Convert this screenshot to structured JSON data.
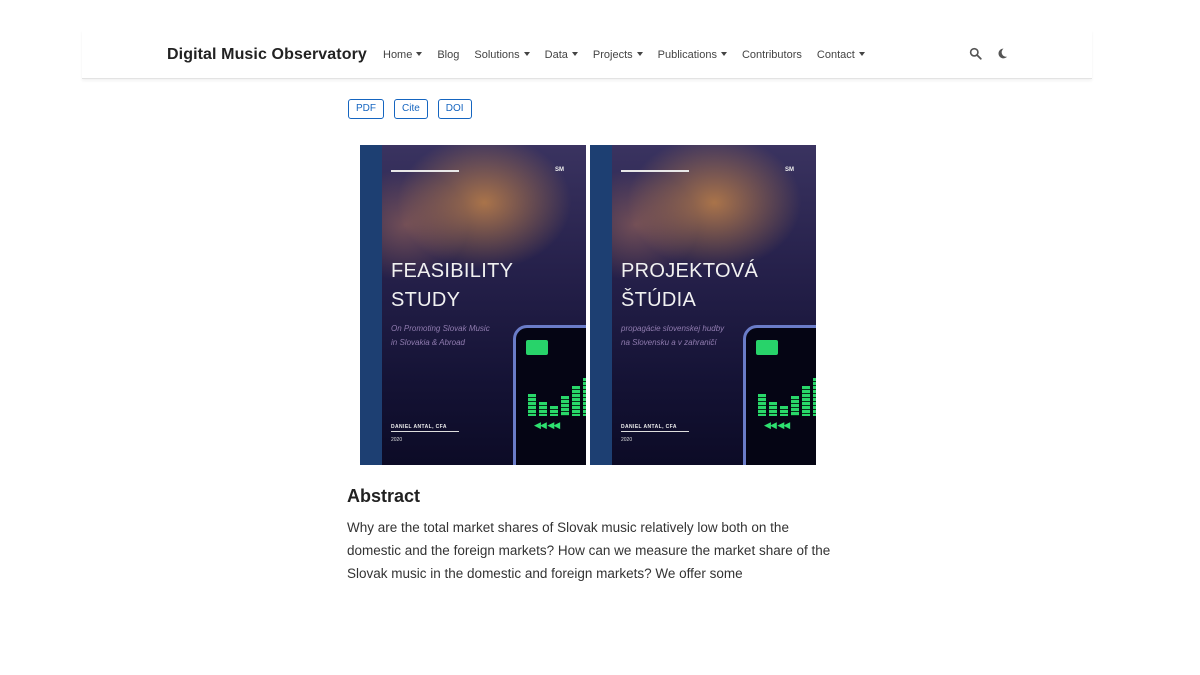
{
  "brand": "Digital Music Observatory",
  "nav": [
    {
      "label": "Home",
      "dropdown": true
    },
    {
      "label": "Blog",
      "dropdown": false
    },
    {
      "label": "Solutions",
      "dropdown": true
    },
    {
      "label": "Data",
      "dropdown": true
    },
    {
      "label": "Projects",
      "dropdown": true
    },
    {
      "label": "Publications",
      "dropdown": true
    },
    {
      "label": "Contributors",
      "dropdown": false
    },
    {
      "label": "Contact",
      "dropdown": true
    }
  ],
  "nav_icons": {
    "search": "search-icon",
    "theme": "moon-icon"
  },
  "buttons": {
    "pdf": "PDF",
    "cite": "Cite",
    "doi": "DOI"
  },
  "colors": {
    "accent": "#1565c0"
  },
  "covers": [
    {
      "logo": "SM",
      "title_line1": "FEASIBILITY",
      "title_line2": "STUDY",
      "subtitle_line1": "On Promoting Slovak Music",
      "subtitle_line2": "in Slovakia & Abroad",
      "author": "DANIEL ANTAL, CFA",
      "year": "2020"
    },
    {
      "logo": "SM",
      "title_line1": "PROJEKTOVÁ",
      "title_line2": "ŠTÚDIA",
      "subtitle_line1": "propagácie slovenskej hudby",
      "subtitle_line2": "na Slovensku a v zahraničí",
      "author": "DANIEL ANTAL, CFA",
      "year": "2020"
    }
  ],
  "abstract": {
    "heading": "Abstract",
    "text": "Why are the total market shares of Slovak music relatively low both on the domestic and the foreign markets? How can we measure the market share of the Slovak music in the domestic and foreign markets? We offer some"
  }
}
